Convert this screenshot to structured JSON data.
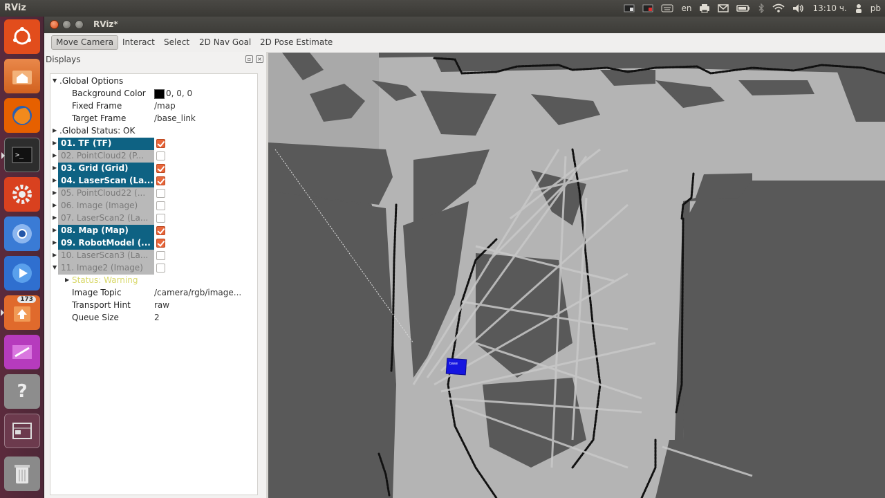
{
  "top_panel": {
    "app_name": "RViz",
    "keyboard_layout": "en",
    "clock": "13:10 ч.",
    "user": "pb",
    "icons": [
      "record-icon",
      "screen-icon",
      "keyboard-icon",
      "printer-icon",
      "mail-icon",
      "battery-icon",
      "bluetooth-icon",
      "wifi-icon",
      "volume-icon",
      "user-icon"
    ]
  },
  "launcher": {
    "items": [
      {
        "name": "ubuntu-dash-icon",
        "color": "#e24d1c"
      },
      {
        "name": "files-icon",
        "color": "#e2722f"
      },
      {
        "name": "firefox-icon",
        "color": "#e66000"
      },
      {
        "name": "terminal-icon",
        "color": "#2d2d2d"
      },
      {
        "name": "settings-icon",
        "color": "#d9411f"
      },
      {
        "name": "chromium-icon",
        "color": "#3a7bd5"
      },
      {
        "name": "media-player-icon",
        "color": "#2f6fcf"
      },
      {
        "name": "software-updater-icon",
        "color": "#e06a2c",
        "badge": "173"
      },
      {
        "name": "image-editor-icon",
        "color": "#b63bbd"
      },
      {
        "name": "help-icon",
        "color": "#8d8d8d"
      },
      {
        "name": "workspace-switcher-icon",
        "color": "#6c3a4d"
      },
      {
        "name": "trash-icon",
        "color": "#8a8a8a"
      }
    ]
  },
  "window": {
    "title": "RViz*"
  },
  "toolbar": {
    "tools": [
      "Move Camera",
      "Interact",
      "Select",
      "2D Nav Goal",
      "2D Pose Estimate"
    ],
    "active": "Move Camera"
  },
  "displays": {
    "title": "Displays",
    "global_options": {
      "label": ".Global Options",
      "background_color_label": "Background Color",
      "background_color_value": "0, 0, 0",
      "fixed_frame_label": "Fixed Frame",
      "fixed_frame_value": "/map",
      "target_frame_label": "Target Frame",
      "target_frame_value": "/base_link"
    },
    "global_status": ".Global Status: OK",
    "items": [
      {
        "label": "01. TF (TF)",
        "enabled": true
      },
      {
        "label": "02. PointCloud2 (P...",
        "enabled": false
      },
      {
        "label": "03. Grid (Grid)",
        "enabled": true
      },
      {
        "label": "04. LaserScan (La...",
        "enabled": true
      },
      {
        "label": "05. PointCloud22 (...",
        "enabled": false
      },
      {
        "label": "06. Image (Image)",
        "enabled": false
      },
      {
        "label": "07. LaserScan2 (La...",
        "enabled": false
      },
      {
        "label": "08. Map (Map)",
        "enabled": true
      },
      {
        "label": "09. RobotModel (...",
        "enabled": true
      },
      {
        "label": "10. LaserScan3 (La...",
        "enabled": false
      },
      {
        "label": "11. Image2 (Image)",
        "enabled": false
      }
    ],
    "image2_props": {
      "status_label": "Status: Warning",
      "image_topic_label": "Image Topic",
      "image_topic_value": "/camera/rgb/image...",
      "transport_hint_label": "Transport Hint",
      "transport_hint_value": "raw",
      "queue_size_label": "Queue Size",
      "queue_size_value": "2"
    }
  },
  "render": {
    "map_free_color": "#b4b4b4",
    "map_unknown_color": "#595959",
    "robot_color": "#1515e0"
  }
}
